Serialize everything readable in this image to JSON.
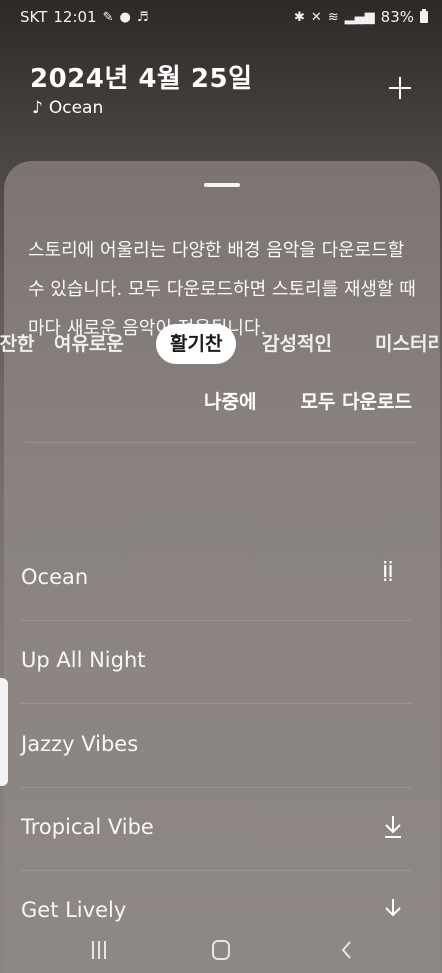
{
  "status_bar": {
    "carrier": "SKT",
    "time": "12:01",
    "battery": "83%"
  },
  "header": {
    "date_title": "2024년 4월 25일",
    "music_note": "♪",
    "music_name": "Ocean"
  },
  "sheet": {
    "info_text": "스토리에 어울리는 다양한 배경 음악을 다운로드할 수 있습니다. 모두 다운로드하면 스토리를 재생할 때마다 새로운 음악이 적용됩니다.",
    "later_label": "나중에",
    "download_all_label": "모두 다운로드"
  },
  "moods": [
    {
      "label": "잔잔한"
    },
    {
      "label": "여유로운"
    },
    {
      "label": "활기찬"
    },
    {
      "label": "감성적인"
    },
    {
      "label": "미스터리"
    }
  ],
  "selected_mood": "활기찬",
  "tracks": [
    {
      "name": "Ocean",
      "icon": "playing-indicator-icon"
    },
    {
      "name": "Up All Night",
      "icon": ""
    },
    {
      "name": "Jazzy Vibes",
      "icon": ""
    },
    {
      "name": "Tropical Vibe",
      "icon": "download-icon"
    },
    {
      "name": "Get Lively",
      "icon": "download-icon"
    }
  ]
}
